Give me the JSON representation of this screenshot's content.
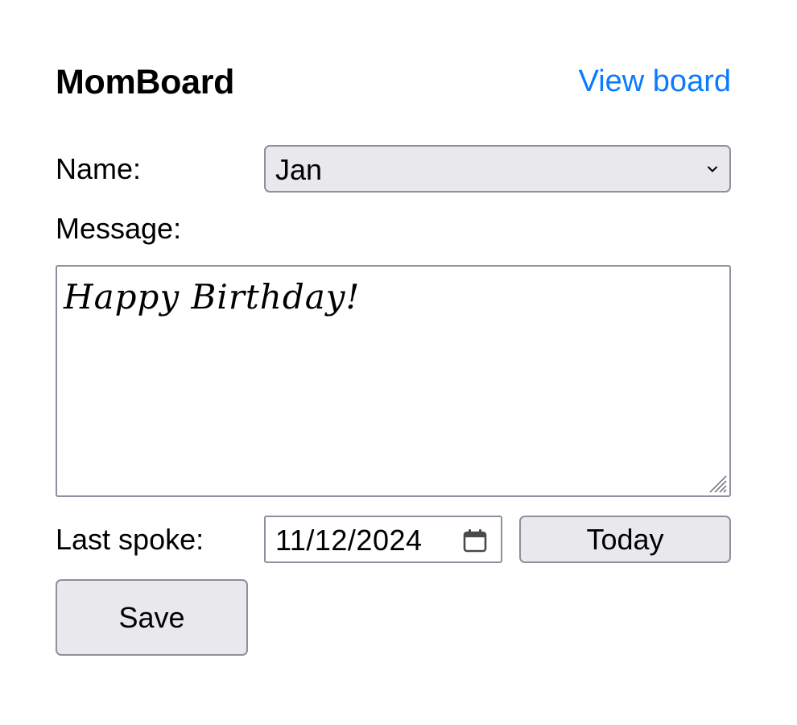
{
  "header": {
    "title": "MomBoard",
    "view_board_link": "View board"
  },
  "form": {
    "name_label": "Name:",
    "name_selected": "Jan",
    "message_label": "Message:",
    "message_value": "Happy Birthday!",
    "last_spoke_label": "Last spoke:",
    "last_spoke_value": "11/12/2024",
    "today_button": "Today",
    "save_button": "Save"
  },
  "icons": {
    "select": "chevron-down-icon",
    "date": "calendar-icon",
    "textarea": "resize-grip-icon"
  },
  "colors": {
    "link": "#0a7bff",
    "button_bg": "#e9e9ed",
    "border": "#8f8f9d"
  }
}
